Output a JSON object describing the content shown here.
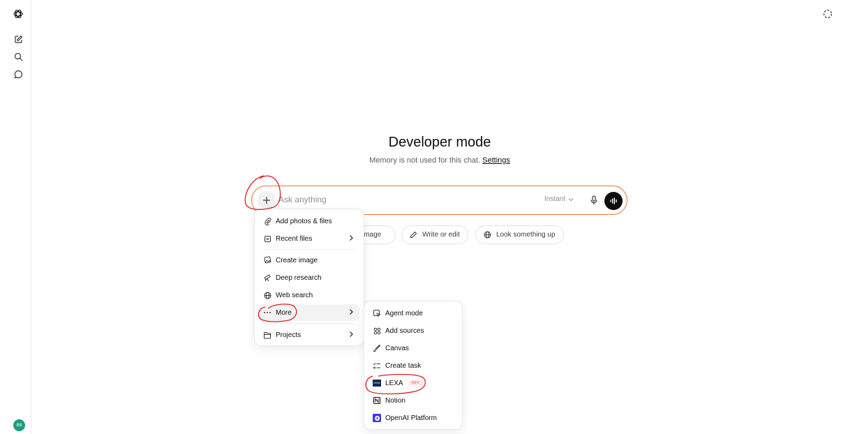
{
  "sidebar": {
    "avatar_initials": "BB"
  },
  "main": {
    "title": "Developer mode",
    "subtitle": "Memory is not used for this chat.",
    "settings_link": "Settings"
  },
  "composer": {
    "placeholder": "Ask anything",
    "model": "Instant"
  },
  "chips": {
    "create_image": "image",
    "write_or_edit": "Write or edit",
    "look_up": "Look something up"
  },
  "plus_menu": {
    "items": [
      {
        "label": "Add photos & files",
        "icon": "paperclip-icon"
      },
      {
        "label": "Recent files",
        "icon": "file-icon"
      },
      {
        "label": "Create image",
        "icon": "image-icon"
      },
      {
        "label": "Deep research",
        "icon": "telescope-icon"
      },
      {
        "label": "Web search",
        "icon": "globe-icon"
      },
      {
        "label": "More",
        "icon": "ellipsis-icon"
      },
      {
        "label": "Projects",
        "icon": "folder-icon"
      }
    ]
  },
  "more_menu": {
    "items": [
      {
        "label": "Agent mode",
        "icon": "agent-icon"
      },
      {
        "label": "Add sources",
        "icon": "sources-icon"
      },
      {
        "label": "Canvas",
        "icon": "canvas-icon"
      },
      {
        "label": "Create task",
        "icon": "task-icon"
      },
      {
        "label": "LEXA",
        "badge": "DEV",
        "logo_text": "LEXA"
      },
      {
        "label": "Notion",
        "icon": "notion-icon"
      },
      {
        "label": "OpenAI Platform",
        "icon": "openai-icon"
      }
    ]
  },
  "colors": {
    "annotation": "#d81f1f",
    "composer_border": "#e5772e",
    "avatar": "#1a9e82"
  }
}
